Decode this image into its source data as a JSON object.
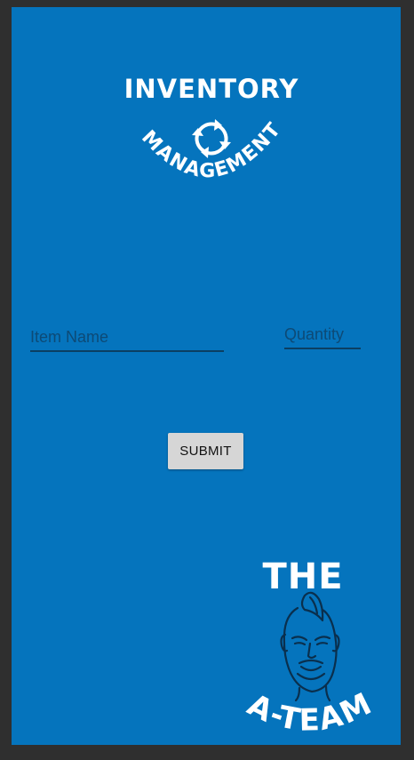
{
  "header_logo": {
    "title": "INVENTORY",
    "subtitle": "MANAGEMENT",
    "icon": "recycle-arrows-icon"
  },
  "form": {
    "item_name_placeholder": "Item Name",
    "quantity_placeholder": "Quantity",
    "submit_label": "SUBMIT"
  },
  "footer_logo": {
    "top_text": "THE",
    "bottom_text": "A-TEAM",
    "icon": "mohawk-face-icon"
  },
  "colors": {
    "background": "#0574bd",
    "frame": "#2f2f2f",
    "button": "#d6d6d6",
    "underline": "#0b3f63"
  }
}
